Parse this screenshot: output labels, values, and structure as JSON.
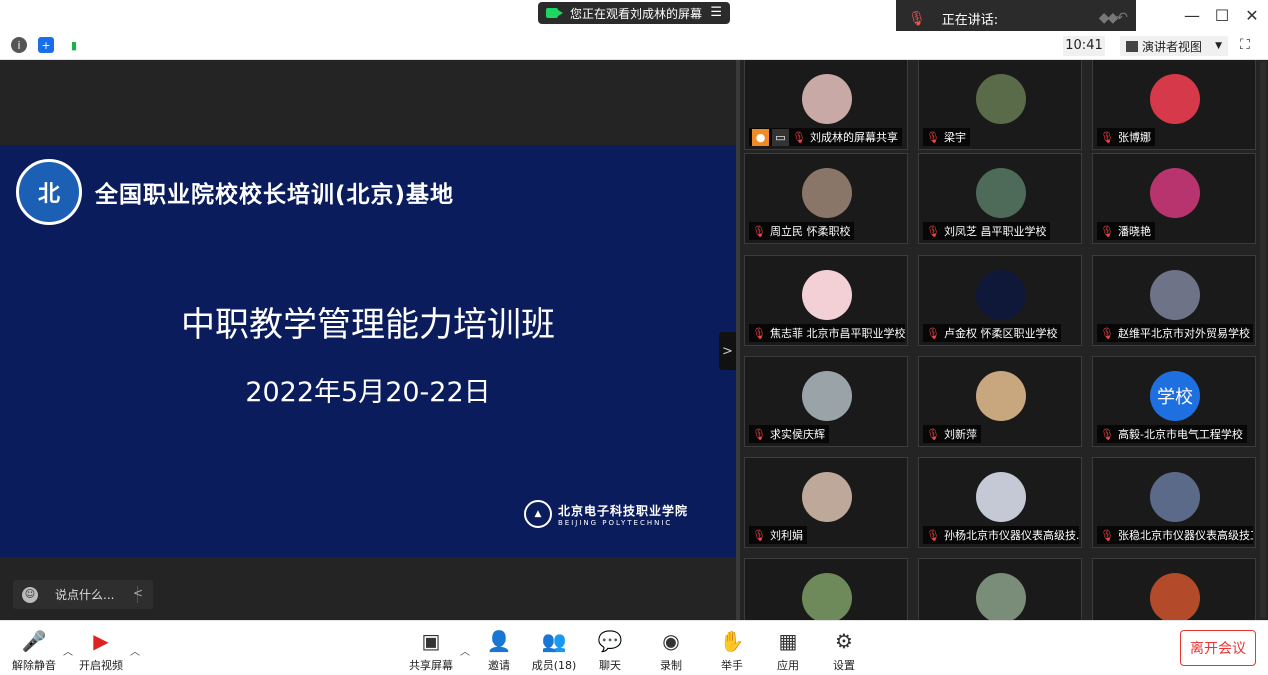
{
  "title_bar": {
    "share_banner": "您正在观看刘成林的屏幕",
    "speaking_label": "正在讲话:",
    "minimize": "—",
    "maximize": "☐",
    "close": "✕"
  },
  "info_bar": {
    "time": "10:41",
    "view_mode": "演讲者视图"
  },
  "slide": {
    "logo_text": "北",
    "org_name": "全国职业院校校长培训(北京)基地",
    "course_title": "中职教学管理能力培训班",
    "date": "2022年5月20-22日",
    "school_cn": "北京电子科技职业学院",
    "school_en": "BEIJING POLYTECHNIC"
  },
  "chat": {
    "placeholder": "说点什么..."
  },
  "participants": [
    {
      "name": "刘成林的屏幕共享",
      "avatar_color": "#c8a9a6",
      "avatar_text": "",
      "host": true
    },
    {
      "name": "梁宇",
      "avatar_color": "#5a6b4a",
      "avatar_text": ""
    },
    {
      "name": "张博娜",
      "avatar_color": "#d63a4a",
      "avatar_text": ""
    },
    {
      "name": "周立民 怀柔职校",
      "avatar_color": "#8a7668",
      "avatar_text": ""
    },
    {
      "name": "刘凤芝  昌平职业学校",
      "avatar_color": "#4e6a58",
      "avatar_text": ""
    },
    {
      "name": "潘晓艳",
      "avatar_color": "#b8346e",
      "avatar_text": ""
    },
    {
      "name": "焦志菲 北京市昌平职业学校",
      "avatar_color": "#f2d0d6",
      "avatar_text": ""
    },
    {
      "name": "卢金权 怀柔区职业学校",
      "avatar_color": "#10183a",
      "avatar_text": ""
    },
    {
      "name": "赵维平北京市对外贸易学校",
      "avatar_color": "#6f7388",
      "avatar_text": ""
    },
    {
      "name": "求实侯庆辉",
      "avatar_color": "#9aa4a8",
      "avatar_text": ""
    },
    {
      "name": "刘新萍",
      "avatar_color": "#c9a77e",
      "avatar_text": ""
    },
    {
      "name": "高毅-北京市电气工程学校",
      "avatar_color": "#1e6fe0",
      "avatar_text": "学校"
    },
    {
      "name": "刘利娟",
      "avatar_color": "#bda89a",
      "avatar_text": ""
    },
    {
      "name": "孙杨北京市仪器仪表高级技...",
      "avatar_color": "#c5c9d6",
      "avatar_text": ""
    },
    {
      "name": "张稳北京市仪器仪表高级技工...",
      "avatar_color": "#5c6a8a",
      "avatar_text": ""
    },
    {
      "name": "",
      "avatar_color": "#6f8a5a",
      "avatar_text": ""
    },
    {
      "name": "",
      "avatar_color": "#7a8d78",
      "avatar_text": ""
    },
    {
      "name": "",
      "avatar_color": "#b34a2a",
      "avatar_text": ""
    }
  ],
  "toolbar": {
    "unmute": "解除静音",
    "start_video": "开启视频",
    "share_screen": "共享屏幕",
    "invite": "邀请",
    "members": "成员(18)",
    "chat": "聊天",
    "record": "录制",
    "raise_hand": "举手",
    "apps": "应用",
    "settings": "设置",
    "leave": "离开会议"
  }
}
